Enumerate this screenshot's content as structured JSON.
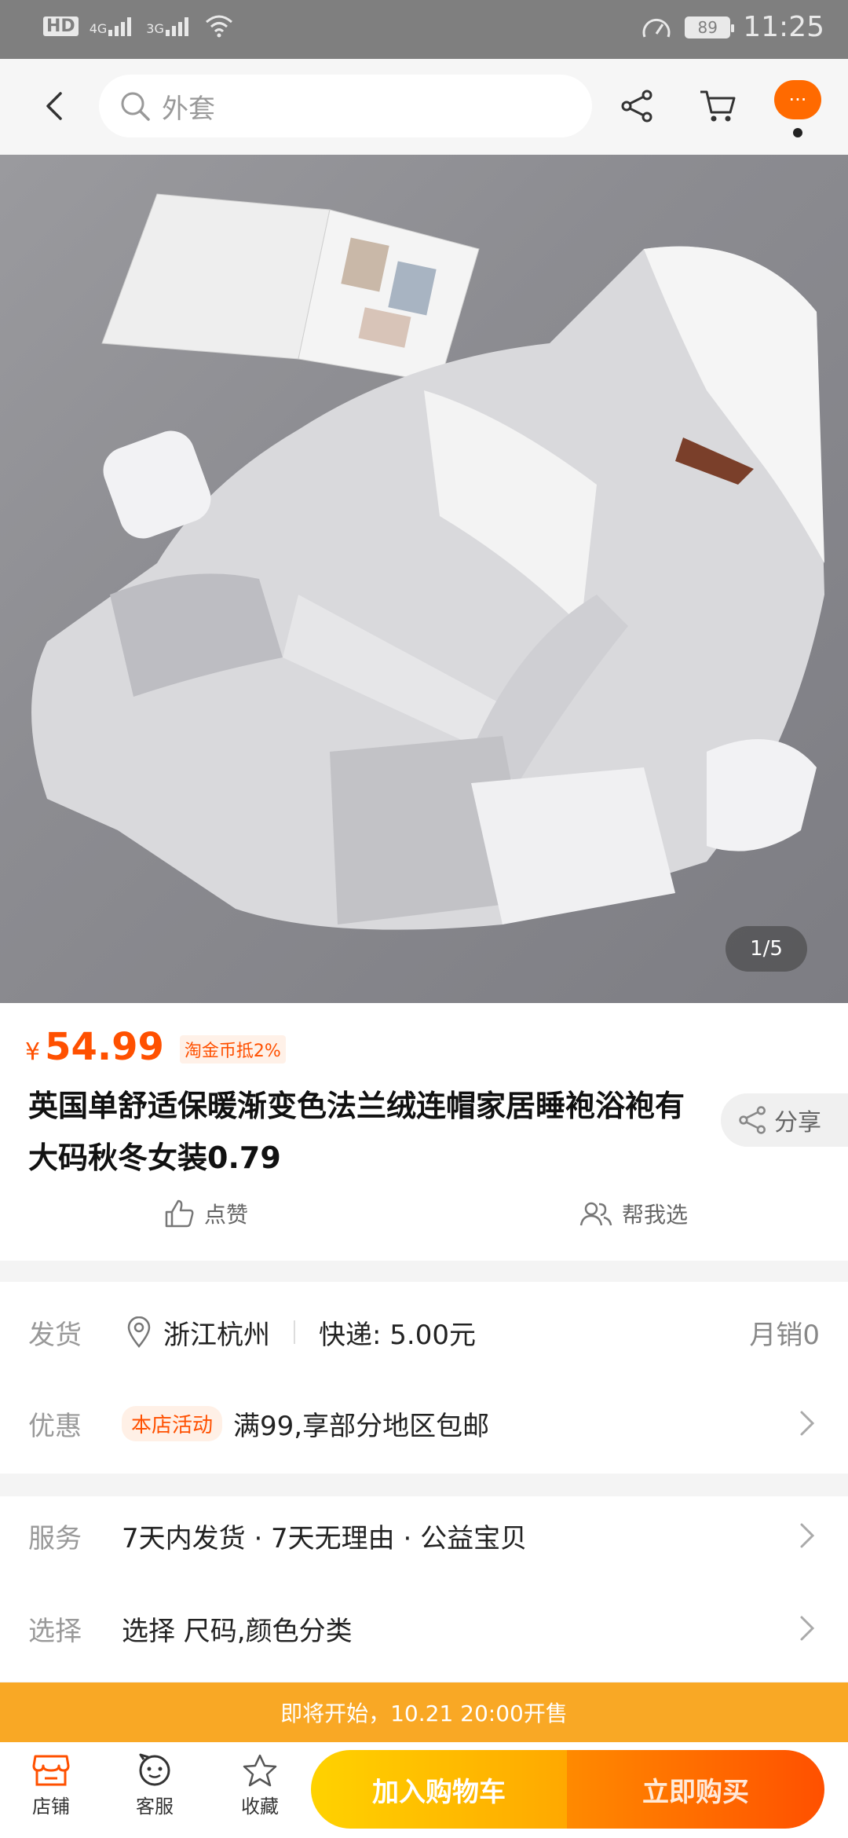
{
  "status_bar": {
    "network": "4G",
    "network2": "3G",
    "battery": "89",
    "time": "11:25",
    "hd_label": "HD"
  },
  "search": {
    "placeholder": "外套"
  },
  "hero": {
    "pager": "1/5"
  },
  "product": {
    "currency": "¥",
    "price": "54.99",
    "coin_tag": "淘金币抵2%",
    "title": "英国单舒适保暖渐变色法兰绒连帽家居睡袍浴袍有大码秋冬女装0.79",
    "share_label": "分享",
    "like_label": "点赞",
    "help_choose_label": "帮我选"
  },
  "delivery": {
    "label": "发货",
    "location": "浙江杭州",
    "shipping": "快递: 5.00元",
    "monthly_sales": "月销0"
  },
  "promo": {
    "label": "优惠",
    "tag": "本店活动",
    "text": "满99,享部分地区包邮"
  },
  "service": {
    "label": "服务",
    "text": "7天内发货 · 7天无理由 · 公益宝贝"
  },
  "select": {
    "label": "选择",
    "text": "选择 尺码,颜色分类"
  },
  "banner": {
    "text": "即将开始，10.21 20:00开售"
  },
  "bottom_bar": {
    "shop": "店铺",
    "service": "客服",
    "favorite": "收藏",
    "add_cart": "加入购物车",
    "buy_now": "立即购买"
  },
  "colors": {
    "accent": "#ff5000",
    "banner": "#f9a825",
    "cart_button": "#ffbe00",
    "buy_button": "#ff6a00"
  }
}
